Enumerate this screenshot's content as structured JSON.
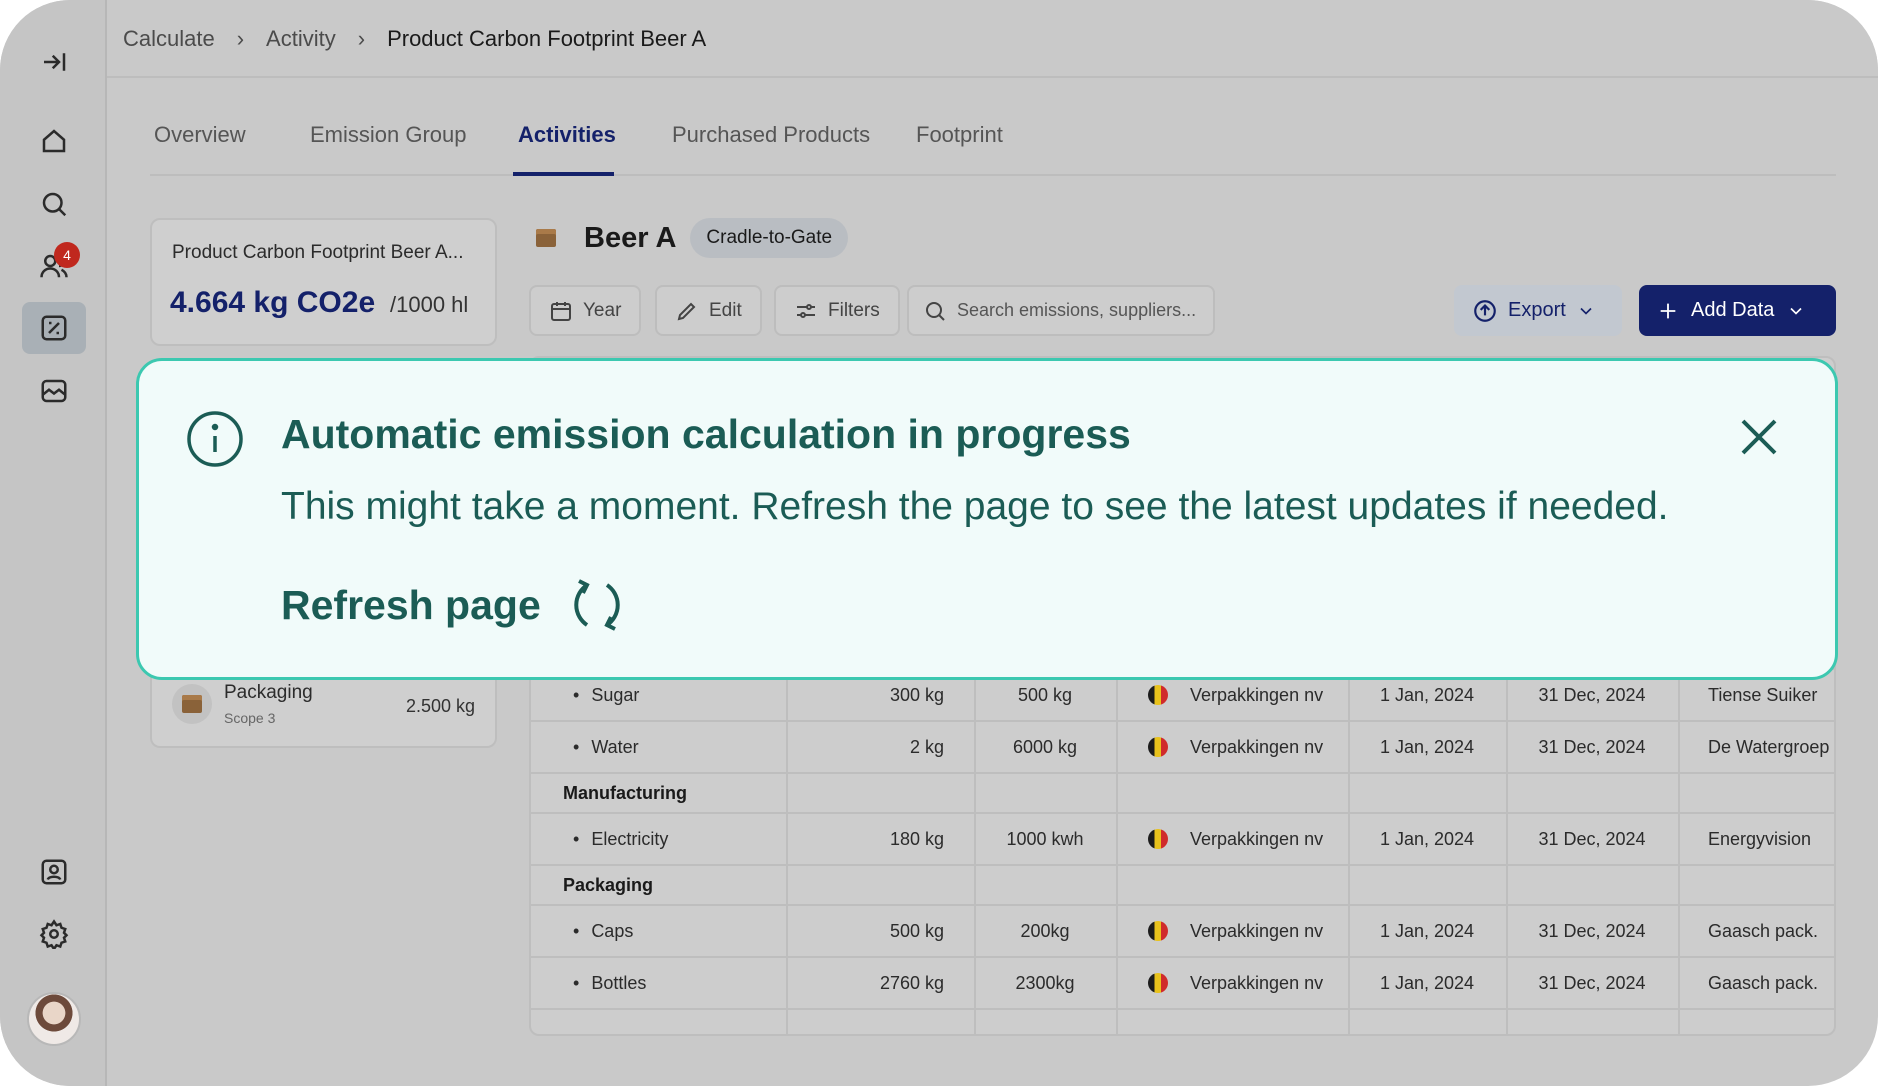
{
  "breadcrumb": [
    "Calculate",
    "Activity",
    "Product Carbon Footprint Beer A"
  ],
  "tabs": [
    "Overview",
    "Emission Group",
    "Activities",
    "Purchased Products",
    "Footprint"
  ],
  "active_tab": "Activities",
  "sidebar": {
    "notification_count": "4"
  },
  "summary": {
    "name": "Product Carbon Footprint Beer A...",
    "value": "4.664 kg CO2e",
    "unit": "/1000 hl"
  },
  "left_list": {
    "item_title": "Packaging",
    "item_scope": "Scope 3",
    "item_amount": "2.500 kg"
  },
  "product": {
    "title": "Beer A",
    "boundary": "Cradle-to-Gate"
  },
  "toolbar": {
    "year": "Year",
    "edit": "Edit",
    "filters": "Filters",
    "search_placeholder": "Search emissions, suppliers...",
    "export": "Export",
    "add_data": "Add Data"
  },
  "table": {
    "rows": [
      {
        "kind": "item",
        "name": "Sugar",
        "qty": "300 kg",
        "amount": "500 kg",
        "supplier": "Verpakkingen nv",
        "start": "1 Jan, 2024",
        "end": "31 Dec, 2024",
        "source": "Tiense Suiker"
      },
      {
        "kind": "item",
        "name": "Water",
        "qty": "2 kg",
        "amount": "6000 kg",
        "supplier": "Verpakkingen nv",
        "start": "1 Jan, 2024",
        "end": "31 Dec, 2024",
        "source": "De Watergroep"
      },
      {
        "kind": "category",
        "name": "Manufacturing"
      },
      {
        "kind": "item",
        "name": "Electricity",
        "qty": "180 kg",
        "amount": "1000 kwh",
        "supplier": "Verpakkingen nv",
        "start": "1 Jan, 2024",
        "end": "31 Dec, 2024",
        "source": "Energyvision"
      },
      {
        "kind": "category",
        "name": "Packaging"
      },
      {
        "kind": "item",
        "name": "Caps",
        "qty": "500 kg",
        "amount": "200kg",
        "supplier": "Verpakkingen nv",
        "start": "1 Jan, 2024",
        "end": "31 Dec, 2024",
        "source": "Gaasch pack."
      },
      {
        "kind": "item",
        "name": "Bottles",
        "qty": "2760 kg",
        "amount": "2300kg",
        "supplier": "Verpakkingen nv",
        "start": "1 Jan, 2024",
        "end": "31 Dec, 2024",
        "source": "Gaasch pack."
      }
    ]
  },
  "alert": {
    "title": "Automatic emission calculation in progress",
    "body": "This might take a moment. Refresh the page to see the latest updates if needed.",
    "action": "Refresh page"
  },
  "colors": {
    "brand": "#14216a",
    "alert_accent": "#1b5c55",
    "alert_border": "#3cc8b0",
    "alert_bg": "#f1fbfa"
  }
}
